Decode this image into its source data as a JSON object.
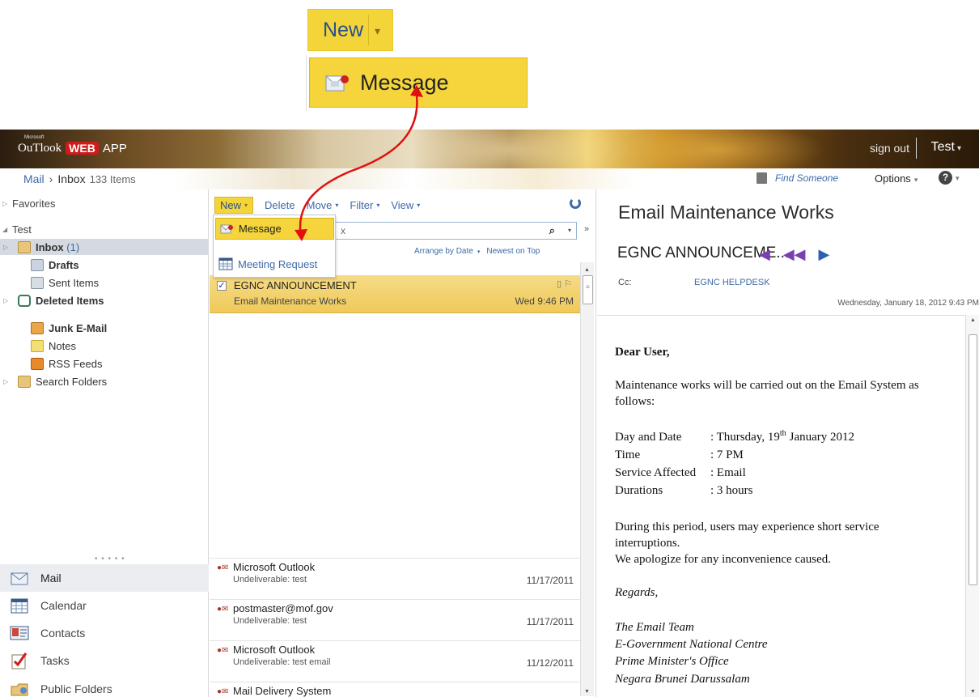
{
  "zoom": {
    "new_label": "New",
    "message_label": "Message"
  },
  "header": {
    "logo_microsoft": "Microsoft",
    "logo_outlook": "OuTlook",
    "logo_web": "WEB",
    "logo_app": "APP",
    "sign_out": "sign out",
    "user": "Test"
  },
  "breadcrumb": {
    "mail": "Mail",
    "inbox": "Inbox",
    "count": "133 Items"
  },
  "topright": {
    "find_someone": "Find Someone",
    "options": "Options",
    "help": "?"
  },
  "nav": {
    "favorites": "Favorites",
    "account": "Test",
    "folders": [
      {
        "label": "Inbox",
        "count": "(1)"
      },
      {
        "label": "Drafts"
      },
      {
        "label": "Sent Items"
      },
      {
        "label": "Deleted Items"
      },
      {
        "label": "Junk E-Mail"
      },
      {
        "label": "Notes"
      },
      {
        "label": "RSS Feeds"
      },
      {
        "label": "Search Folders"
      }
    ],
    "grip": "• • • • •",
    "modules": [
      "Mail",
      "Calendar",
      "Contacts",
      "Tasks",
      "Public Folders"
    ]
  },
  "toolbar": {
    "new": "New",
    "delete": "Delete",
    "move": "Move",
    "filter": "Filter",
    "view": "View"
  },
  "search": {
    "placeholder_tail": "x"
  },
  "arrange": {
    "by": "Arrange by Date",
    "order": "Newest on Top"
  },
  "dropdown": {
    "message": "Message",
    "meeting": "Meeting Request"
  },
  "selected": {
    "from": "EGNC ANNOUNCEMENT",
    "subject": "Email Maintenance Works",
    "date": "Wed 9:46 PM"
  },
  "messages": [
    {
      "from": "Microsoft Outlook",
      "subject": "Undeliverable: test",
      "date": "11/17/2011"
    },
    {
      "from": "postmaster@mof.gov",
      "subject": "Undeliverable: test",
      "date": "11/17/2011"
    },
    {
      "from": "Microsoft Outlook",
      "subject": "Undeliverable: test email",
      "date": "11/12/2011"
    },
    {
      "from": "Mail Delivery System",
      "subject": "",
      "date": ""
    }
  ],
  "reading": {
    "title": "Email Maintenance Works",
    "subject": "EGNC ANNOUNCEME...",
    "cc_label": "Cc:",
    "cc": "EGNC HELPDESK",
    "date": "Wednesday, January 18, 2012 9:43 PM",
    "greeting": "Dear User,",
    "intro1": "Maintenance works will be carried out on the Email System as",
    "intro2": "follows:",
    "day_label": "Day and Date",
    "day_value_a": ": Thursday, 19",
    "day_value_sup": "th",
    "day_value_b": "January 2012",
    "time_label": "Time",
    "time_value": ": 7 PM",
    "svc_label": "Service Affected",
    "svc_value": ": Email",
    "dur_label": "Durations",
    "dur_value": ": 3 hours",
    "period1": "During this period, users may experience short service",
    "period2": "interruptions.",
    "apology": "We apologize for any inconvenience caused.",
    "regards": "Regards,",
    "sig1": "The Email Team",
    "sig2": "E-Government National Centre",
    "sig3": "Prime Minister's Office",
    "sig4": "Negara Brunei Darussalam"
  },
  "colors": {
    "accent_yellow": "#f3d53a",
    "link_blue": "#3d6aa8",
    "arrow_red": "#e01010"
  }
}
